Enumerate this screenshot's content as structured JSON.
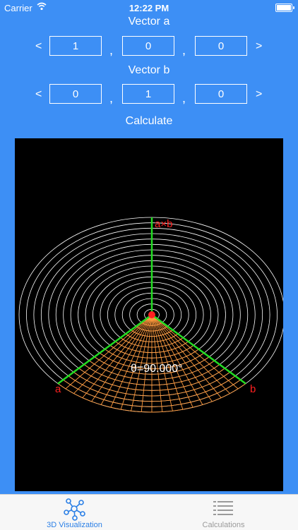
{
  "status": {
    "carrier": "Carrier",
    "time": "12:22 PM"
  },
  "vector_a": {
    "title": "Vector a",
    "x": "1",
    "y": "0",
    "z": "0"
  },
  "vector_b": {
    "title": "Vector b",
    "x": "0",
    "y": "1",
    "z": "0"
  },
  "nav": {
    "prev": "<",
    "next": ">",
    "separator": ","
  },
  "calculate_label": "Calculate",
  "viz": {
    "cross_label": "a×b",
    "a_label": "a",
    "b_label": "b",
    "angle_label": "θ=90.000°",
    "colors": {
      "grid": "#ffffff",
      "arc": "#ff9a3c",
      "vector": "#22dd22",
      "label": "#ff2020",
      "origin": "#ff2020"
    }
  },
  "tabs": [
    {
      "label": "3D Visualization",
      "icon": "network-icon",
      "active": true
    },
    {
      "label": "Calculations",
      "icon": "list-icon",
      "active": false
    }
  ]
}
